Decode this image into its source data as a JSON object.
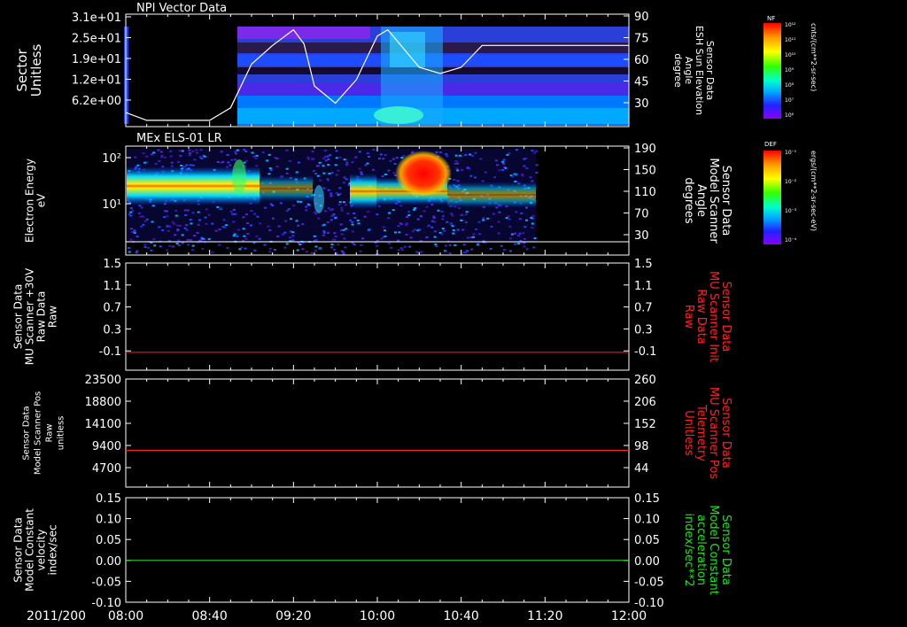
{
  "date_label": "2011/200",
  "time_ticks": [
    "08:00",
    "08:40",
    "09:20",
    "10:00",
    "10:40",
    "11:20",
    "12:00"
  ],
  "panels": [
    {
      "title": "NPI Vector Data",
      "left_label": [
        "Sector",
        "Unitless"
      ],
      "left_ticks": [
        "3.1e+01",
        "2.5e+01",
        "1.9e+01",
        "1.2e+01",
        "6.2e+00"
      ],
      "right_label": [
        "Sensor Data",
        "ESH Sun Elevation",
        "Angle",
        "degree"
      ],
      "right_ticks": [
        "90",
        "75",
        "60",
        "45",
        "30"
      ],
      "colorbar": {
        "name": "NF",
        "units": "cnts/(cm**2-sr-sec)",
        "ticks": [
          "10¹²",
          "10¹¹",
          "10¹⁰",
          "10⁹",
          "10⁸",
          "10⁷",
          "10⁶"
        ]
      }
    },
    {
      "title": "MEx ELS-01 LR",
      "left_label": [
        "Electron Energy",
        "eV"
      ],
      "left_ticks": [
        "10²",
        "10¹"
      ],
      "right_label": [
        "Sensor Data",
        "Model Scanner",
        "Angle",
        "degrees"
      ],
      "right_ticks": [
        "190",
        "150",
        "110",
        "70",
        "30"
      ],
      "colorbar": {
        "name": "DEF",
        "units": "ergs/(cm**2-sr-sec-eV)",
        "ticks": [
          "10⁻¹",
          "10⁻²",
          "10⁻³",
          "10⁻⁴"
        ]
      }
    },
    {
      "left_label": [
        "Sensor Data",
        "MU Scanner +30V",
        "Raw Data",
        "Raw"
      ],
      "left_ticks": [
        "1.5",
        "1.1",
        "0.7",
        "0.3",
        "-0.1"
      ],
      "right_label": [
        "Sensor Data",
        "MU Scanner Init",
        "Raw Data",
        "Raw"
      ],
      "right_ticks": [
        "1.5",
        "1.1",
        "0.7",
        "0.3",
        "-0.1"
      ]
    },
    {
      "left_label": [
        "Sensor Data",
        "Model Scanner Pos",
        "Raw",
        "unitless"
      ],
      "left_ticks": [
        "23500",
        "18800",
        "14100",
        "9400",
        "4700"
      ],
      "right_label": [
        "Sensor Data",
        "MU Scanner Pos",
        "Telemetry",
        "Unitless"
      ],
      "right_ticks": [
        "260",
        "206",
        "152",
        "98",
        "44"
      ]
    },
    {
      "left_label": [
        "Sensor Data",
        "Model Constant",
        "velocity",
        "index/sec"
      ],
      "left_ticks": [
        "0.15",
        "0.10",
        "0.05",
        "0.00",
        "-0.05",
        "-0.10"
      ],
      "right_label": [
        "Sensor Data",
        "Model Constant",
        "acceleration",
        "index/sec**2"
      ],
      "right_ticks": [
        "0.15",
        "0.10",
        "0.05",
        "0.00",
        "-0.05",
        "-0.10"
      ]
    }
  ],
  "chart_data": [
    {
      "type": "line",
      "title": "NPI Vector Data",
      "xlabel": "2011/200",
      "x": [
        "08:00",
        "08:10",
        "08:20",
        "08:30",
        "08:40",
        "08:50",
        "09:00",
        "09:10",
        "09:20",
        "09:25",
        "09:30",
        "09:40",
        "09:50",
        "10:00",
        "10:05",
        "10:10",
        "10:20",
        "10:30",
        "10:40",
        "10:50",
        "11:00",
        "11:20",
        "12:00"
      ],
      "series": [
        {
          "values": [
            27,
            22,
            22,
            22,
            22,
            30,
            58,
            70,
            80,
            71,
            44,
            33,
            48,
            76,
            80,
            72,
            56,
            52,
            56,
            70,
            70,
            70,
            70
          ]
        }
      ],
      "ylabel": "Sensor Data ESH Sun Elevation Angle degree",
      "ylim": [
        18,
        90
      ],
      "colors": {
        "line": "#ffffff"
      }
    },
    {
      "type": "heatmap",
      "title": "MEx ELS-01 LR",
      "ylabel": "Electron Energy eV",
      "xlim": [
        "08:00",
        "11:20"
      ],
      "ylim": [
        1,
        200
      ],
      "colorbar_label": "DEF",
      "log_scale_y": true
    },
    {
      "type": "line",
      "xlim": [
        "08:00",
        "12:00"
      ],
      "ylim": [
        -0.3,
        1.5
      ],
      "series": [
        {
          "name": "Sensor Data MU Scanner Init Raw Data Raw",
          "values": [
            0,
            0
          ]
        }
      ],
      "x": [
        "08:00",
        "12:00"
      ],
      "colors": {
        "line": "#ff2020",
        "label": "#ff2020"
      }
    },
    {
      "type": "line",
      "xlim": [
        "08:00",
        "12:00"
      ],
      "ylim": [
        0,
        23500
      ],
      "series": [
        {
          "name": "Sensor Data MU Scanner Pos Telemetry Unitless",
          "values": [
            8000,
            8000
          ]
        }
      ],
      "x": [
        "08:00",
        "12:00"
      ],
      "colors": {
        "line": "#ff2020",
        "label": "#ff2020"
      }
    },
    {
      "type": "line",
      "xlim": [
        "08:00",
        "12:00"
      ],
      "ylim": [
        -0.1,
        0.15
      ],
      "series": [
        {
          "name": "Sensor Data Model Constant acceleration index/sec**2",
          "values": [
            0,
            0
          ]
        }
      ],
      "x": [
        "08:00",
        "12:00"
      ],
      "colors": {
        "line": "#20e020",
        "label": "#20e020"
      }
    }
  ]
}
